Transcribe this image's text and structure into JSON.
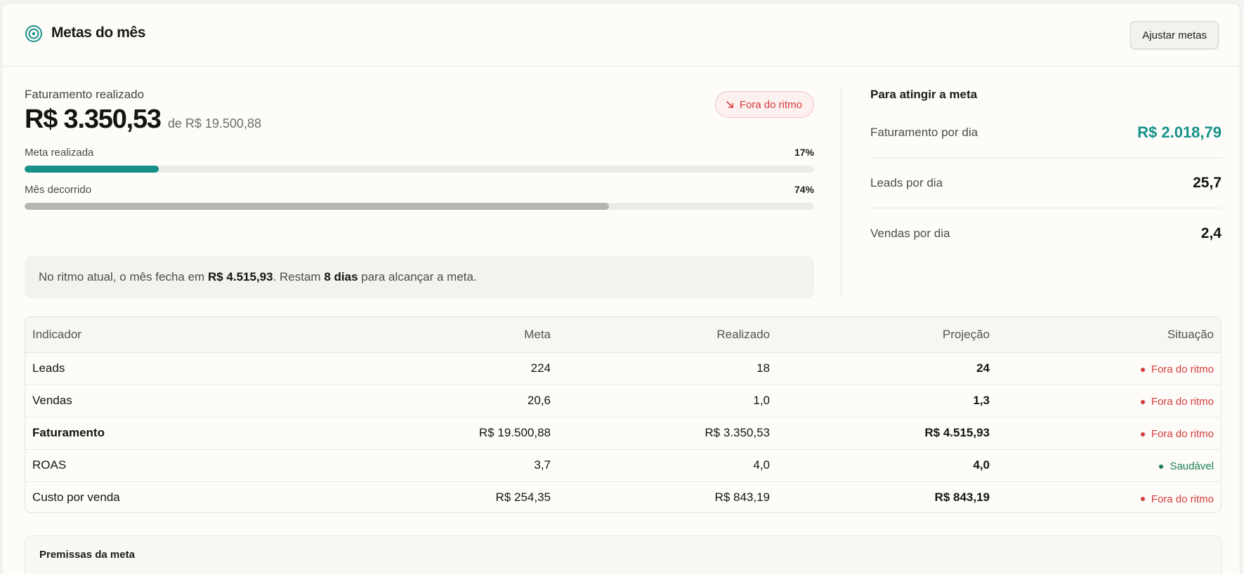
{
  "header": {
    "title": "Metas do mês",
    "adjust_button": "Ajustar metas"
  },
  "revenue": {
    "label": "Faturamento realizado",
    "value": "R$ 3.350,53",
    "of_text": "de R$ 19.500,88",
    "status": "Fora do ritmo"
  },
  "progress": [
    {
      "label": "Meta realizada",
      "pct_text": "17%",
      "fraction": 0.17,
      "color": "#16918a"
    },
    {
      "label": "Mês decorrido",
      "pct_text": "74%",
      "fraction": 0.74,
      "color": "#b4b6b0"
    }
  ],
  "summary": {
    "prefix": "No ritmo atual, o mês fecha em ",
    "projection": "R$ 4.515,93",
    "middle": ". Restam ",
    "days": "8 dias",
    "suffix": " para alcançar a meta."
  },
  "target": {
    "title": "Para atingir a meta",
    "rows": [
      {
        "label": "Faturamento por dia",
        "value": "R$ 2.018,79"
      },
      {
        "label": "Leads por dia",
        "value": "25,7"
      },
      {
        "label": "Vendas por dia",
        "value": "2,4"
      }
    ]
  },
  "table": {
    "headers": [
      "Indicador",
      "Meta",
      "Realizado",
      "Projeção",
      "Situação"
    ],
    "rows": [
      {
        "name": "Leads",
        "meta": "224",
        "realizado": "18",
        "projecao": "24",
        "situacao": "Fora do ritmo",
        "status": "bad"
      },
      {
        "name": "Vendas",
        "meta": "20,6",
        "realizado": "1,0",
        "projecao": "1,3",
        "situacao": "Fora do ritmo",
        "status": "bad"
      },
      {
        "name": "Faturamento",
        "meta": "R$ 19.500,88",
        "realizado": "R$ 3.350,53",
        "projecao": "R$ 4.515,93",
        "situacao": "Fora do ritmo",
        "status": "bad"
      },
      {
        "name": "ROAS",
        "meta": "3,7",
        "realizado": "4,0",
        "projecao": "4,0",
        "situacao": "Saudável",
        "status": "good"
      },
      {
        "name": "Custo por venda",
        "meta": "R$ 254,35",
        "realizado": "R$ 843,19",
        "projecao": "R$ 843,19",
        "situacao": "Fora do ritmo",
        "status": "bad"
      }
    ]
  },
  "premissas": {
    "title": "Premissas da meta"
  },
  "colors": {
    "accent": "#16918a",
    "bad": "#d63b3b",
    "good": "#1a7f4e"
  },
  "icons": {
    "header": "target-icon",
    "status": "arrow-down-right-icon"
  }
}
